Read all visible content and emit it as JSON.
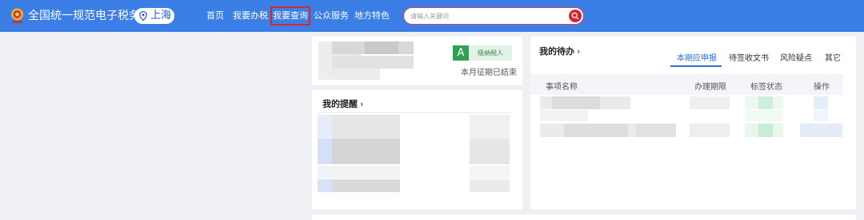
{
  "header": {
    "site_title": "全国统一规范电子税务局",
    "region": "上海",
    "nav": [
      {
        "label": "首页"
      },
      {
        "label": "我要办税"
      },
      {
        "label": "我要查询"
      },
      {
        "label": "公众服务"
      },
      {
        "label": "地方特色"
      }
    ],
    "search_placeholder": "请输入关键词"
  },
  "taxpayer": {
    "credit_grade": "A",
    "credit_label": "级纳税人",
    "period_status": "本月征期已结束"
  },
  "reminders": {
    "title": "我的提醒",
    "chevron": "›"
  },
  "todo": {
    "title": "我的待办",
    "chevron": "›",
    "tabs": [
      {
        "label": "本期应申报"
      },
      {
        "label": "待签收文书"
      },
      {
        "label": "风险疑点"
      },
      {
        "label": "其它"
      }
    ],
    "columns": [
      "事项名称",
      "办理期限",
      "标签状态",
      "操作"
    ]
  },
  "colors": {
    "header_bg": "#3a7ee6",
    "active_nav_outline": "#d8262e",
    "grade_green": "#2ea152",
    "tab_active": "#2b6fe0"
  },
  "icons": {
    "emblem": "tax-emblem-icon",
    "region": "location-pin-icon",
    "search": "search-icon"
  }
}
